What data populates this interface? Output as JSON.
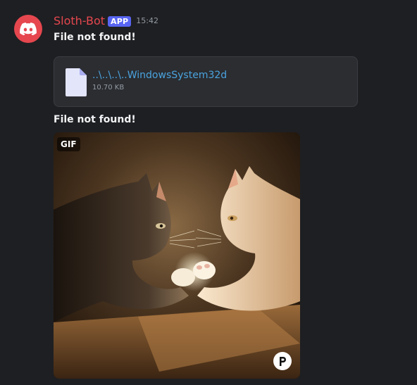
{
  "message": {
    "author": "Sloth-Bot",
    "badge": "APP",
    "timestamp": "15:42",
    "avatar_icon": "discord-logo-icon",
    "colors": {
      "author": "#e6474f",
      "badge": "#5865f2",
      "link": "#4aa3df",
      "background": "#1e1f22"
    }
  },
  "first_text": "File not found!",
  "attachment": {
    "icon": "file-document-icon",
    "name": "..\\..\\..\\..WindowsSystem32d",
    "size": "10.70 KB"
  },
  "second_text": "File not found!",
  "gif": {
    "badge": "GIF",
    "description_icon": "cats-arm-wrestling-image",
    "provider_icon": "provider-p-logo-icon"
  }
}
